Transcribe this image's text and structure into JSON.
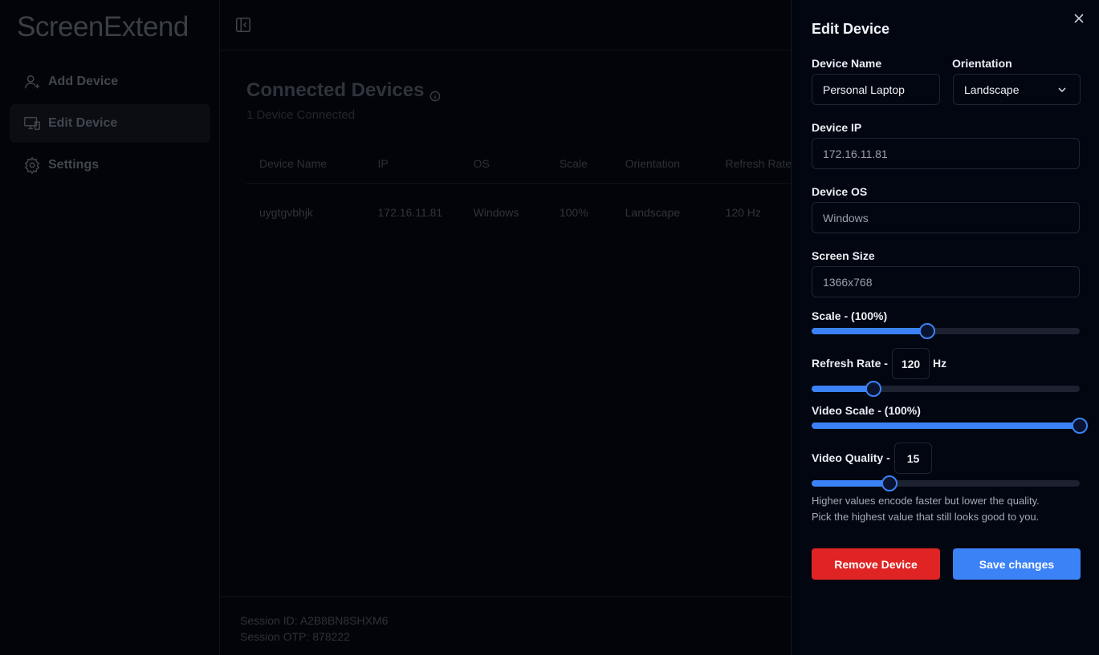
{
  "app": {
    "title": "ScreenExtend"
  },
  "sidebar": {
    "items": [
      {
        "label": "Add Device",
        "icon": "user-plus-icon"
      },
      {
        "label": "Edit Device",
        "icon": "devices-icon",
        "active": true
      },
      {
        "label": "Settings",
        "icon": "gear-icon"
      }
    ]
  },
  "main": {
    "title": "Connected Devices",
    "subtitle": "1 Device Connected",
    "table": {
      "columns": [
        "Device Name",
        "IP",
        "OS",
        "Scale",
        "Orientation",
        "Refresh Rate"
      ],
      "rows": [
        [
          "uygtgvbhjk",
          "172.16.11.81",
          "Windows",
          "100%",
          "Landscape",
          "120 Hz"
        ]
      ]
    },
    "session": {
      "id_text": "Session ID: A2B8BN8SHXM6",
      "otp_text": "Session OTP: 878222"
    }
  },
  "panel": {
    "title": "Edit Device",
    "device_name": {
      "label": "Device Name",
      "value": "Personal Laptop"
    },
    "orientation": {
      "label": "Orientation",
      "value": "Landscape"
    },
    "device_ip": {
      "label": "Device IP",
      "value": "172.16.11.81"
    },
    "device_os": {
      "label": "Device OS",
      "value": "Windows"
    },
    "screen_size": {
      "label": "Screen Size",
      "value": "1366x768"
    },
    "scale": {
      "label": "Scale - (100%)",
      "level": 0.43
    },
    "refresh_rate": {
      "label": "Refresh Rate -",
      "value": "120",
      "unit": "Hz",
      "level": 0.23
    },
    "video_scale": {
      "label": "Video Scale - (100%)",
      "level": 1.0
    },
    "video_quality": {
      "label": "Video Quality -",
      "value": "15",
      "level": 0.29
    },
    "hint_line1": "Higher values encode faster but lower the quality.",
    "hint_line2": "Pick the highest value that still looks good to you.",
    "remove_label": "Remove Device",
    "save_label": "Save changes"
  },
  "colors": {
    "accent": "#3b82f6",
    "danger": "#e02424",
    "background": "#020409"
  }
}
